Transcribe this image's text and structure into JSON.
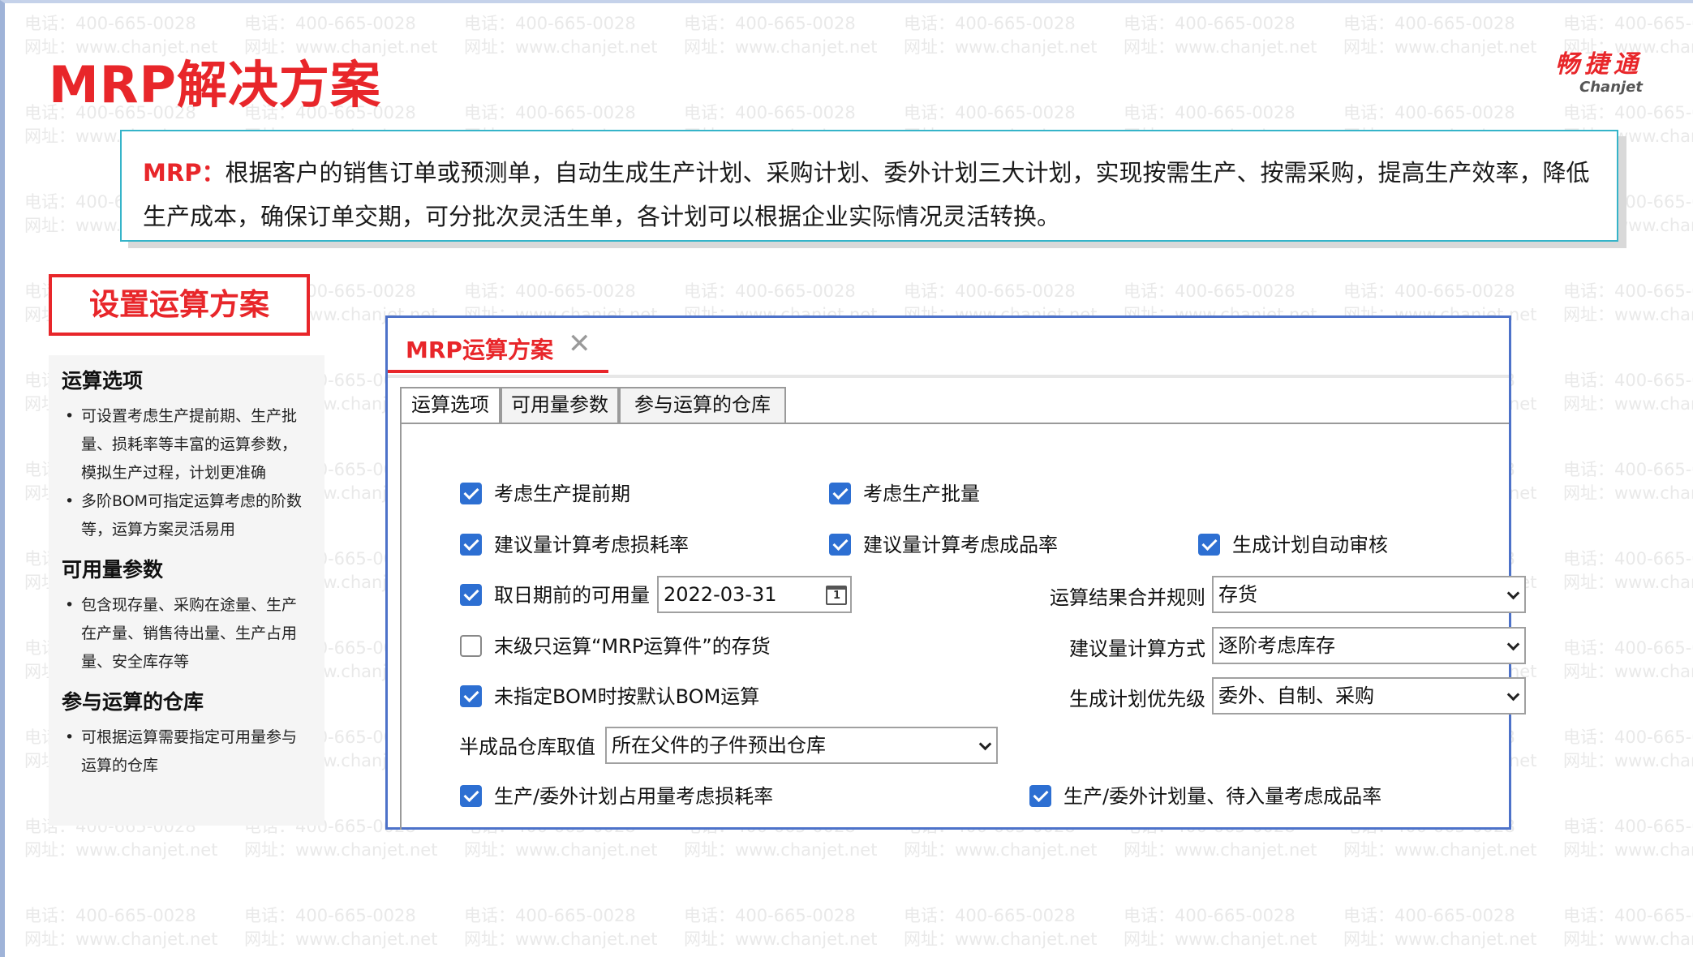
{
  "page": {
    "title": "MRP解决方案",
    "logo_cn": "畅捷通",
    "logo_en": "Chanjet",
    "watermark_phone": "电话：400-665-0028",
    "watermark_site": "网址：www.chanjet.net"
  },
  "intro": {
    "lead": "MRP：",
    "text": "根据客户的销售订单或预测单，自动生成生产计划、采购计划、委外计划三大计划，实现按需生产、按需采购，提高生产效率，降低生产成本，确保订单交期，可分批次灵活生单，各计划可以根据企业实际情况灵活转换。"
  },
  "section_button": "设置运算方案",
  "sidebar": {
    "groups": [
      {
        "title": "运算选项",
        "items": [
          "可设置考虑生产提前期、生产批量、损耗率等丰富的运算参数，模拟生产过程，计划更准确",
          "多阶BOM可指定运算考虑的阶数等，运算方案灵活易用"
        ]
      },
      {
        "title": "可用量参数",
        "items": [
          "包含现存量、采购在途量、生产在产量、销售待出量、生产占用量、安全库存等"
        ]
      },
      {
        "title": "参与运算的仓库",
        "items": [
          "可根据运算需要指定可用量参与运算的仓库"
        ]
      }
    ]
  },
  "window": {
    "tab_label": "MRP运算方案",
    "close_glyph": "✕",
    "subtabs": [
      "运算选项",
      "可用量参数",
      "参与运算的仓库"
    ],
    "checks": {
      "lead_time": {
        "label": "考虑生产提前期",
        "checked": true
      },
      "batch": {
        "label": "考虑生产批量",
        "checked": true
      },
      "loss_rate": {
        "label": "建议量计算考虑损耗率",
        "checked": true
      },
      "yield_rate": {
        "label": "建议量计算考虑成品率",
        "checked": true
      },
      "auto_audit": {
        "label": "生成计划自动审核",
        "checked": true
      },
      "date_available": {
        "label": "取日期前的可用量",
        "checked": true
      },
      "last_level": {
        "label": "末级只运算“MRP运算件”的存货",
        "checked": false
      },
      "default_bom": {
        "label": "未指定BOM时按默认BOM运算",
        "checked": true
      },
      "occupy_loss": {
        "label": "生产/委外计划占用量考虑损耗率",
        "checked": true
      },
      "plan_yield": {
        "label": "生产/委外计划量、待入量考虑成品率",
        "checked": true
      }
    },
    "date_value": "2022-03-31",
    "calendar_day": "1",
    "fields": {
      "merge_rule": {
        "label": "运算结果合并规则",
        "value": "存货"
      },
      "calc_method": {
        "label": "建议量计算方式",
        "value": "逐阶考虑库存"
      },
      "priority": {
        "label": "生成计划优先级",
        "value": "委外、自制、采购"
      },
      "semi_warehouse": {
        "label": "半成品仓库取值",
        "value": "所在父件的子件预出仓库"
      }
    }
  }
}
